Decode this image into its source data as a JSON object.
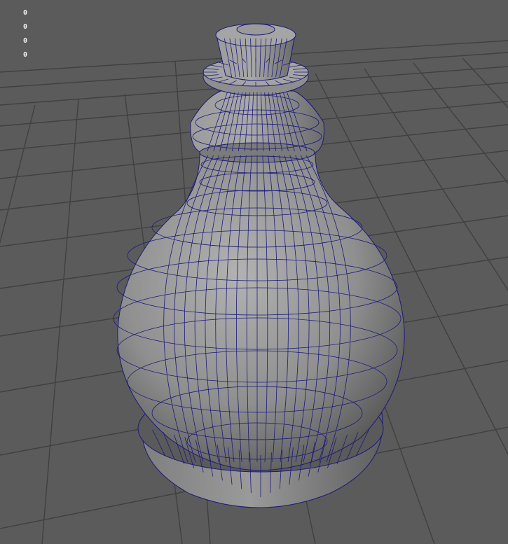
{
  "viewport": {
    "background": "#5b5b5b",
    "grid_color": "#404040",
    "mesh_fill_light": "#ababab",
    "mesh_fill_dark": "#4a4a4a",
    "wireframe_color": "#1c1a7a",
    "object_icon": "bottle-mesh-icon"
  },
  "hud": {
    "lines": [
      "0",
      "0",
      "0",
      "0"
    ]
  }
}
